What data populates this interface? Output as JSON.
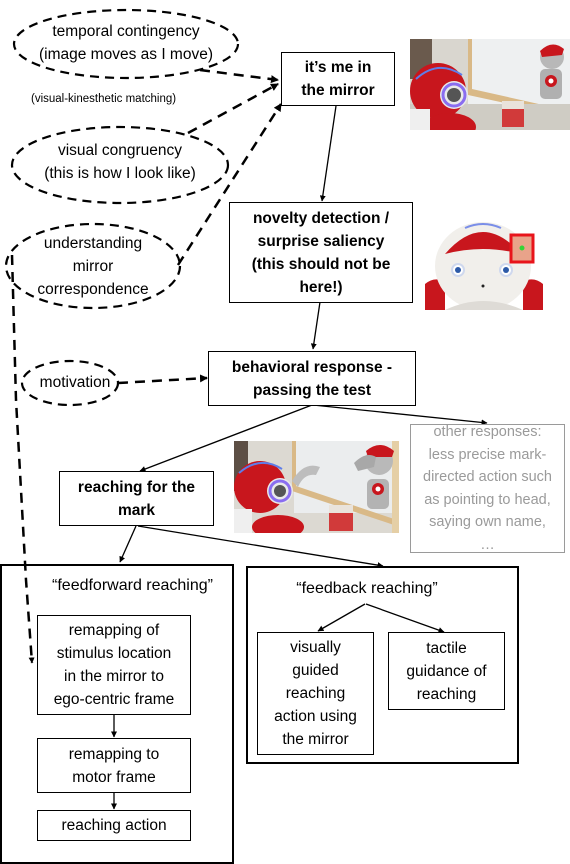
{
  "ellipses": {
    "temporal": "temporal contingency\n(image moves as I move)",
    "visual_congruency": "visual congruency\n(this is how I look like)",
    "understanding": "understanding\nmirror\ncorrespondence",
    "motivation": "motivation"
  },
  "annotation": "(visual-kinesthetic matching)",
  "nodes": {
    "its_me": "it’s me in\nthe mirror",
    "novelty": "novelty detection /\nsurprise saliency\n(this should not be\nhere!)",
    "behavioral": "behavioral response -\npassing the test",
    "other_responses": "other responses:\nless precise mark-\ndirected action such\nas pointing to head,\nsaying own name,\n…",
    "reaching_mark": "reaching for the\nmark",
    "remap_stimulus": "remapping of\nstimulus location\nin the mirror to\nego-centric frame",
    "remap_motor": "remapping to\nmotor frame",
    "reaching_action": "reaching action",
    "visually_guided": "visually\nguided\nreaching\naction using\nthe mirror",
    "tactile": "tactile\nguidance of\nreaching"
  },
  "groups": {
    "feedforward": "“feedforward reaching”",
    "feedback": "“feedback reaching”"
  },
  "photos": {
    "robot_mirror_1": "robot-in-front-of-mirror-photo",
    "robot_head_mark": "robot-head-with-mark-photo",
    "robot_mirror_reaching": "robot-reaching-for-mark-photo"
  },
  "colors": {
    "line": "#000000",
    "muted": "#9a9a9a",
    "robot_red": "#c8161d",
    "mark_highlight": "#e8141b",
    "mark_dot": "#35d435"
  }
}
